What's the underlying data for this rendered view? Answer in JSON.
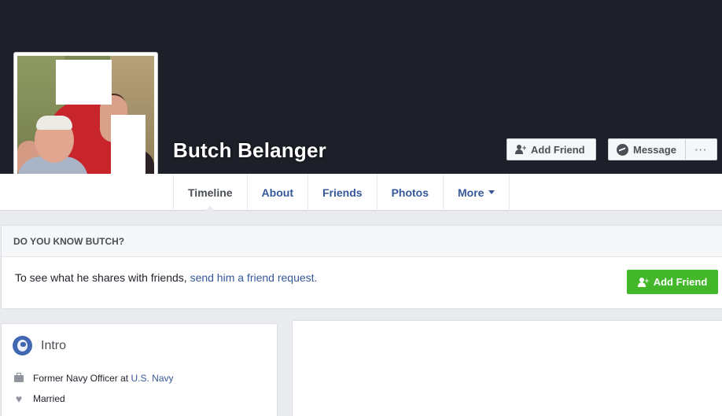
{
  "profile": {
    "name": "Butch Belanger"
  },
  "cover_actions": {
    "add_friend_label": "Add Friend",
    "message_label": "Message",
    "more_label": "···"
  },
  "nav": {
    "tabs": [
      {
        "label": "Timeline"
      },
      {
        "label": "About"
      },
      {
        "label": "Friends"
      },
      {
        "label": "Photos"
      },
      {
        "label": "More"
      }
    ]
  },
  "know": {
    "header": "DO YOU KNOW BUTCH?",
    "text": "To see what he shares with friends, ",
    "link": "send him a friend request.",
    "button_label": "Add Friend"
  },
  "intro": {
    "title": "Intro",
    "work_prefix": "Former Navy Officer at ",
    "work_link": "U.S. Navy",
    "relationship": "Married"
  },
  "colors": {
    "cover": "#1d2029",
    "link": "#365899",
    "green": "#42b72a"
  }
}
